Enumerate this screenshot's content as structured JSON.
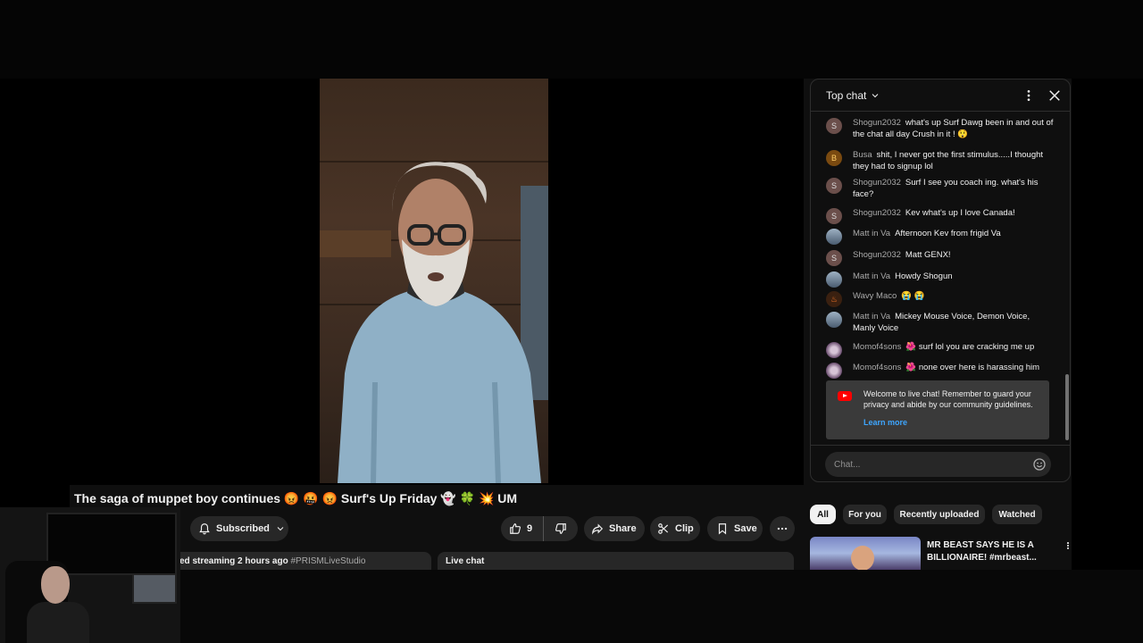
{
  "video": {
    "title": "The saga of muppet boy continues 😡 🤬 😡 Surf's Up Friday 👻 🍀 💥 UM"
  },
  "actions": {
    "subscribe_label": "Subscribed",
    "like_count": "9",
    "share_label": "Share",
    "clip_label": "Clip",
    "save_label": "Save"
  },
  "description": {
    "streamed_text": "ed streaming 2 hours ago",
    "hashtag": "#PRISMLiveStudio",
    "live_chat_label": "Live chat"
  },
  "chat": {
    "header_label": "Top chat",
    "input_placeholder": "Chat...",
    "messages": [
      {
        "author": "Shogun2032",
        "avatar_letter": "S",
        "text": "what's up Surf Dawg been in and out of the chat all day Crush in it ! 😲"
      },
      {
        "author": "Busa",
        "avatar_letter": "B",
        "text": "shit, I never got the first stimulus.....I thought they had to signup lol"
      },
      {
        "author": "Shogun2032",
        "avatar_letter": "S",
        "text": "Surf I see you coach ing. what's his face?"
      },
      {
        "author": "Shogun2032",
        "avatar_letter": "S",
        "text": "Kev what's up I love Canada!"
      },
      {
        "author": "Matt in Va",
        "avatar_letter": "",
        "text": "Afternoon Kev from frigid Va"
      },
      {
        "author": "Shogun2032",
        "avatar_letter": "S",
        "text": "Matt GENX!"
      },
      {
        "author": "Matt in Va",
        "avatar_letter": "",
        "text": "Howdy Shogun"
      },
      {
        "author": "Wavy Maco",
        "avatar_letter": "♨",
        "text": "😭 😭"
      },
      {
        "author": "Matt in Va",
        "avatar_letter": "",
        "text": "Mickey Mouse Voice, Demon Voice, Manly Voice"
      },
      {
        "author": "Momof4sons",
        "author_badge": "🌺",
        "avatar_letter": "",
        "text": "surf lol you are cracking me up"
      },
      {
        "author": "Momof4sons",
        "author_badge": "🌺",
        "avatar_letter": "",
        "text": "none over here is harassing him"
      }
    ],
    "welcome": {
      "text": "Welcome to live chat! Remember to guard your privacy and abide by our community guidelines.",
      "learn_more": "Learn more"
    }
  },
  "chips": [
    "All",
    "For you",
    "Recently uploaded",
    "Watched"
  ],
  "recommendation": {
    "title": "MR BEAST SAYS HE IS A BILLIONAIRE! #mrbeast..."
  },
  "colors": {
    "background": "#0f0f0f",
    "pill": "#272727",
    "link": "#3ea6ff",
    "youtube_red": "#ff0000"
  }
}
